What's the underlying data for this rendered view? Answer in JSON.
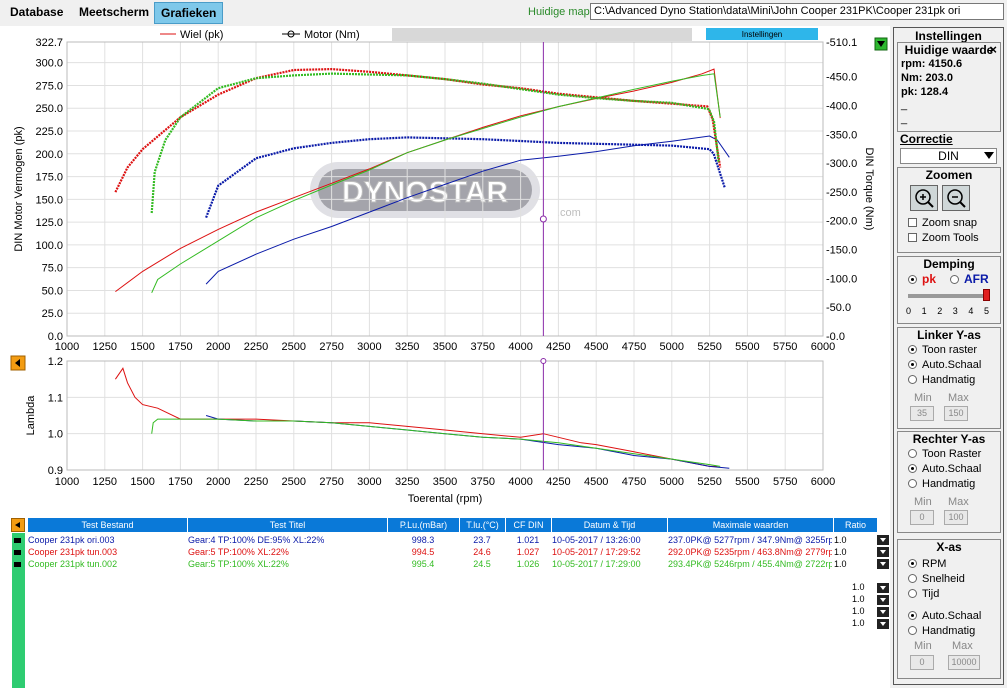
{
  "tabs": [
    {
      "label": "Database",
      "active": false
    },
    {
      "label": "Meetscherm",
      "active": false
    },
    {
      "label": "Grafieken",
      "active": true
    }
  ],
  "path": {
    "label": "Huidige map",
    "value": "C:\\Advanced Dyno Station\\data\\Mini\\John Cooper  231PK\\Cooper 231pk ori"
  },
  "legend": {
    "wheel": "Wiel (pk)",
    "motor": "Motor (Nm)",
    "settings_btn": "Instellingen"
  },
  "watermark": {
    "brand": "DYNOSTAR",
    "suffix": ".com"
  },
  "chart_data": [
    {
      "type": "line",
      "name": "power-torque",
      "xlabel": "",
      "ylabel": "DIN Motor Vermogen (pk)",
      "y2label": "DIN Torque (Nm)",
      "xlim": [
        1000,
        6000
      ],
      "ylim": [
        0,
        322.7
      ],
      "y2lim": [
        0,
        510.1
      ],
      "xticks": [
        1000,
        1250,
        1500,
        1750,
        2000,
        2250,
        2500,
        2750,
        3000,
        3250,
        3500,
        3750,
        4000,
        4250,
        4500,
        4750,
        5000,
        5250,
        5500,
        5750,
        6000
      ],
      "yticks": [
        0,
        25,
        50,
        75,
        100,
        125,
        150,
        175,
        200,
        225,
        250,
        275,
        300,
        322.7
      ],
      "ytick_labels": [
        "0.0",
        "25.0",
        "50.0",
        "75.0",
        "100.0",
        "125.0",
        "150.0",
        "175.0",
        "200.0",
        "225.0",
        "250.0",
        "275.0",
        "300.0",
        "322.7"
      ],
      "y2ticks": [
        0,
        50,
        100,
        150,
        200,
        250,
        300,
        350,
        400,
        450,
        510.1
      ],
      "y2tick_labels": [
        "-0.0",
        "-50.0",
        "-100.0",
        "-150.0",
        "-200.0",
        "-250.0",
        "-300.0",
        "-350.0",
        "-400.0",
        "-450.0",
        "-510.1"
      ],
      "cursor_x": 4150.6,
      "series": [
        {
          "color": "#0a1aa8",
          "kind": "power",
          "x": [
            1920,
            2000,
            2250,
            2500,
            2750,
            3000,
            3250,
            3500,
            3750,
            4000,
            4250,
            4500,
            4750,
            5000,
            5250,
            5277,
            5350
          ],
          "y": [
            130,
            165,
            195,
            206,
            212,
            216,
            218,
            217,
            216,
            214,
            212,
            211,
            210,
            209,
            205,
            200,
            163
          ]
        },
        {
          "color": "#0a1aa8",
          "kind": "torque",
          "x": [
            1920,
            2000,
            2250,
            2500,
            2750,
            3000,
            3250,
            3500,
            3750,
            4000,
            4250,
            4500,
            4750,
            5000,
            5250,
            5300,
            5380
          ],
          "y": [
            90,
            112,
            142,
            168,
            190,
            215,
            240,
            263,
            286,
            305,
            312,
            320,
            330,
            338,
            347,
            340,
            310
          ]
        },
        {
          "color": "#dd1111",
          "kind": "power",
          "x": [
            1320,
            1400,
            1500,
            1750,
            2000,
            2250,
            2500,
            2750,
            3000,
            3250,
            3500,
            3750,
            4000,
            4250,
            4500,
            4750,
            5000,
            5235,
            5270,
            5320
          ],
          "y": [
            158,
            185,
            205,
            240,
            265,
            283,
            292,
            293,
            290,
            286,
            282,
            276,
            272,
            266,
            262,
            258,
            255,
            252,
            238,
            185
          ]
        },
        {
          "color": "#dd1111",
          "kind": "torque",
          "x": [
            1320,
            1500,
            1750,
            2000,
            2250,
            2500,
            2750,
            3000,
            3250,
            3500,
            3750,
            4000,
            4250,
            4500,
            4750,
            5000,
            5200,
            5279,
            5320
          ],
          "y": [
            77,
            112,
            152,
            185,
            215,
            240,
            265,
            290,
            318,
            340,
            362,
            382,
            398,
            412,
            425,
            440,
            455,
            463,
            378
          ]
        },
        {
          "color": "#33bb22",
          "kind": "power",
          "x": [
            1560,
            1580,
            1650,
            1750,
            2000,
            2250,
            2500,
            2750,
            3000,
            3250,
            3500,
            3750,
            4000,
            4250,
            4500,
            4750,
            5000,
            5246,
            5280,
            5310
          ],
          "y": [
            135,
            180,
            215,
            240,
            272,
            283,
            286,
            288,
            287,
            286,
            282,
            277,
            271,
            265,
            261,
            258,
            256,
            249,
            235,
            190
          ]
        },
        {
          "color": "#33bb22",
          "kind": "torque",
          "x": [
            1560,
            1600,
            1750,
            2000,
            2250,
            2500,
            2750,
            3000,
            3250,
            3500,
            3750,
            4000,
            4250,
            4500,
            4750,
            5000,
            5200,
            5280,
            5320
          ],
          "y": [
            75,
            98,
            125,
            165,
            205,
            235,
            262,
            288,
            318,
            340,
            360,
            380,
            398,
            413,
            428,
            442,
            452,
            455,
            380
          ]
        }
      ]
    },
    {
      "type": "line",
      "name": "lambda",
      "xlabel": "Toerental (rpm)",
      "ylabel": "Lambda",
      "xlim": [
        1000,
        6000
      ],
      "ylim": [
        0.9,
        1.2
      ],
      "xticks": [
        1000,
        1250,
        1500,
        1750,
        2000,
        2250,
        2500,
        2750,
        3000,
        3250,
        3500,
        3750,
        4000,
        4250,
        4500,
        4750,
        5000,
        5250,
        5500,
        5750,
        6000
      ],
      "yticks": [
        0.9,
        1.0,
        1.1,
        1.2
      ],
      "ytick_labels": [
        "0.9",
        "1.0",
        "1.1",
        "1.2"
      ],
      "series": [
        {
          "color": "#dd1111",
          "x": [
            1320,
            1370,
            1400,
            1450,
            1500,
            1600,
            1750,
            2000,
            2250,
            2500,
            2750,
            3000,
            3250,
            3500,
            3750,
            4000,
            4150,
            4250,
            4400,
            4500,
            4750,
            5000,
            5250,
            5300
          ],
          "y": [
            1.15,
            1.18,
            1.14,
            1.1,
            1.08,
            1.07,
            1.04,
            1.04,
            1.04,
            1.035,
            1.03,
            1.03,
            1.02,
            1.01,
            1.0,
            0.99,
            1.0,
            0.99,
            0.975,
            0.97,
            0.95,
            0.93,
            0.91,
            0.91
          ]
        },
        {
          "color": "#0a1aa8",
          "x": [
            1920,
            2000,
            2250,
            2500,
            2750,
            3000,
            3250,
            3500,
            3750,
            4000,
            4250,
            4500,
            4750,
            5000,
            5250,
            5380
          ],
          "y": [
            1.05,
            1.04,
            1.035,
            1.035,
            1.03,
            1.02,
            1.01,
            1.0,
            0.99,
            0.985,
            0.97,
            0.96,
            0.94,
            0.93,
            0.91,
            0.905
          ]
        },
        {
          "color": "#33bb22",
          "x": [
            1560,
            1570,
            1600,
            1750,
            2000,
            2250,
            2500,
            2750,
            3000,
            3250,
            3500,
            3750,
            4000,
            4250,
            4500,
            4750,
            5000,
            5250,
            5320
          ],
          "y": [
            1.0,
            1.03,
            1.04,
            1.04,
            1.04,
            1.035,
            1.035,
            1.03,
            1.02,
            1.01,
            1.0,
            0.99,
            0.985,
            0.975,
            0.96,
            0.945,
            0.93,
            0.915,
            0.91
          ]
        }
      ]
    }
  ],
  "panel": {
    "title": "Instellingen",
    "huidige_title": "Huidige waarde",
    "rpm": "rpm: 4150.6",
    "nm": "Nm: 203.0",
    "pk": "pk: 128.4",
    "dash1": "_",
    "dash2": "_",
    "correctie_title": "Correctie",
    "correctie_value": "DIN",
    "zoomen_title": "Zoomen",
    "zoom_snap": "Zoom snap",
    "zoom_tools": "Zoom Tools",
    "demping_title": "Demping",
    "demping_pk": "pk",
    "demping_afr": "AFR",
    "slider_ticks": [
      "0",
      "1",
      "2",
      "3",
      "4",
      "5"
    ],
    "demping_value": 5,
    "linker_title": "Linker Y-as",
    "toon_raster": "Toon raster",
    "auto_schaal": "Auto.Schaal",
    "handmatig": "Handmatig",
    "min_label": "Min",
    "max_label": "Max",
    "linker_min": "35",
    "linker_max": "150",
    "rechter_title": "Rechter Y-as",
    "toon_raster_r": "Toon Raster",
    "rechter_min": "0",
    "rechter_max": "100",
    "xas_title": "X-as",
    "rpm_opt": "RPM",
    "snelheid_opt": "Snelheid",
    "tijd_opt": "Tijd",
    "xas_min": "0",
    "xas_max": "10000"
  },
  "table": {
    "headers": [
      "Test Bestand",
      "Test Titel",
      "P.Lu.(mBar)",
      "T.lu.(°C)",
      "CF DIN",
      "Datum & Tijd",
      "Maximale waarden",
      "Ratio"
    ],
    "rows": [
      {
        "color": "#0a1aa8",
        "file": "Cooper 231pk ori.003",
        "title": "Gear:4 TP:100% DE:95% XL:22%",
        "plu": "998.3",
        "tlu": "23.7",
        "cf": "1.021",
        "datum": "10-05-2017 / 13:26:00",
        "max": "237.0PK@ 5277rpm / 347.9Nm@ 3255rpm",
        "ratio": "1.0"
      },
      {
        "color": "#dd1111",
        "file": "Cooper 231pk tun.003",
        "title": "Gear:5 TP:100% XL:22%",
        "plu": "994.5",
        "tlu": "24.6",
        "cf": "1.027",
        "datum": "10-05-2017 / 17:29:52",
        "max": "292.0PK@ 5235rpm / 463.8Nm@ 2779rpm",
        "ratio": "1.0"
      },
      {
        "color": "#33bb22",
        "file": "Cooper 231pk tun.002",
        "title": "Gear:5 TP:100% XL:22%",
        "plu": "995.4",
        "tlu": "24.5",
        "cf": "1.026",
        "datum": "10-05-2017 / 17:29:00",
        "max": "293.4PK@ 5246rpm / 455.4Nm@ 2722rpm",
        "ratio": "1.0"
      }
    ],
    "empty_ratios": [
      "1.0",
      "1.0",
      "1.0",
      "1.0"
    ]
  },
  "colors": {
    "accent": "#0a79d8",
    "red": "#dd1111",
    "green": "#33bb22",
    "blue": "#0a1aa8",
    "cursor": "#8a2aa8"
  }
}
